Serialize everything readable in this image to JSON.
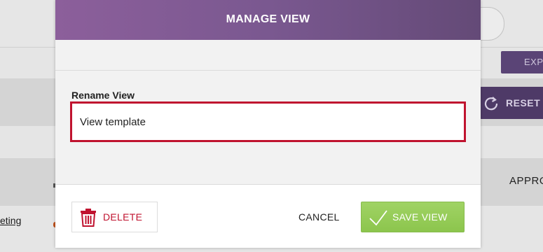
{
  "modal": {
    "title": "MANAGE VIEW",
    "rename_label": "Rename View",
    "rename_value": "View template",
    "delete_label": "DELETE",
    "cancel_label": "CANCEL",
    "save_label": "SAVE VIEW"
  },
  "background": {
    "export_label": "EXPO",
    "reset_label": "RESET",
    "approx_label": "APPRO",
    "link_text": "eting"
  },
  "colors": {
    "header_gradient_start": "#8c5f9b",
    "header_gradient_end": "#644a77",
    "input_border": "#c0132f",
    "delete_red": "#c0132f",
    "save_green": "#8cc54d",
    "bg_button_purple": "#5a4476"
  },
  "icons": {
    "delete": "trash-icon",
    "save": "checkmark-icon",
    "reset": "refresh-icon"
  }
}
